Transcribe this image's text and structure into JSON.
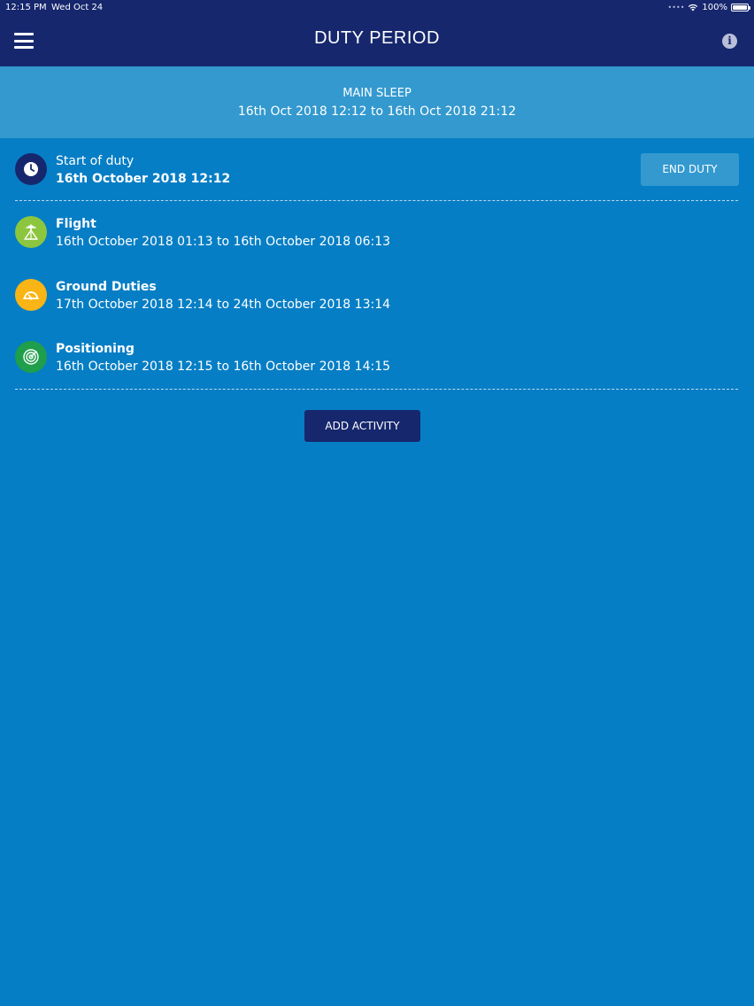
{
  "status_bar": {
    "time": "12:15 PM",
    "date": "Wed Oct 24",
    "battery": "100%",
    "wifi_icon": "wifi-icon",
    "battery_icon": "battery-icon"
  },
  "header": {
    "title": "DUTY PERIOD",
    "menu_icon": "hamburger-menu-icon",
    "info_icon": "info-icon",
    "background": "#16276d"
  },
  "sleep_banner": {
    "title": "MAIN SLEEP",
    "range": "16th Oct 2018 12:12 to 16th Oct 2018 21:12",
    "background": "#3399cf"
  },
  "duty_start": {
    "label": "Start of duty",
    "datetime": "16th October 2018 12:12",
    "icon": "clock-icon",
    "icon_color": "#16276d",
    "end_button": "END DUTY"
  },
  "activities": [
    {
      "label": "Flight",
      "range": "16th October 2018 01:13 to 16th October 2018 06:13",
      "icon": "flight-icon",
      "color": "#8cc63f"
    },
    {
      "label": "Ground Duties",
      "range": "17th October 2018 12:14 to 24th October 2018 13:14",
      "icon": "ground-duties-icon",
      "color": "#f9b515"
    },
    {
      "label": "Positioning",
      "range": "16th October 2018 12:15 to 16th October 2018 14:15",
      "icon": "positioning-icon",
      "color": "#1f9e4b"
    }
  ],
  "add_activity_button": "ADD ACTIVITY",
  "colors": {
    "page_background": "#067ec5",
    "header": "#16276d",
    "banner": "#3399cf"
  }
}
